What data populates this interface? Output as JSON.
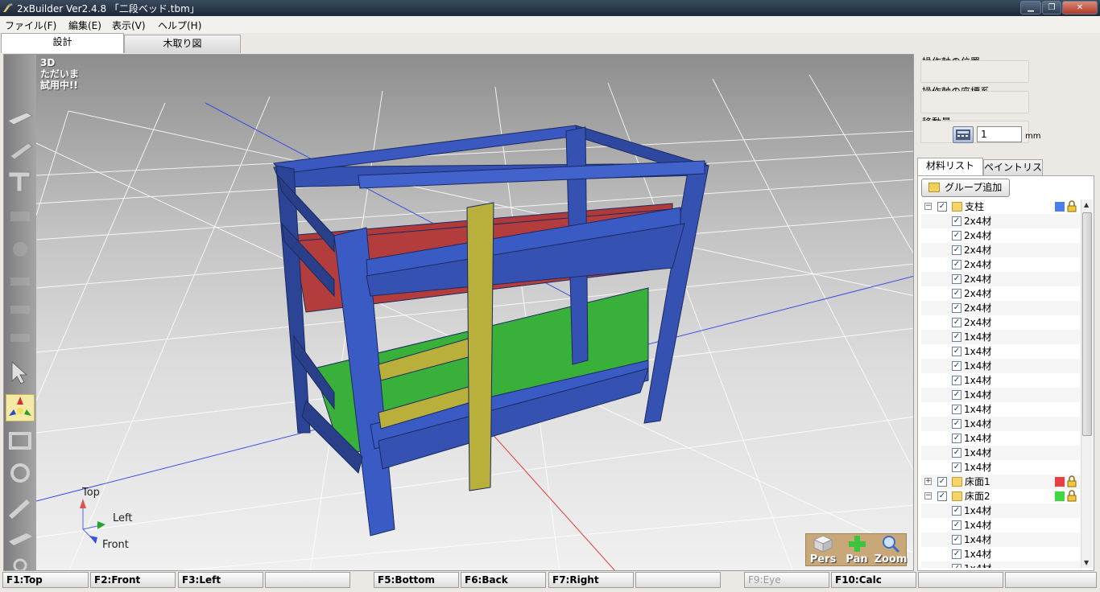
{
  "window": {
    "title": "2xBuilder Ver2.4.8 「二段ベッド.tbm」",
    "buttons": [
      "minimize",
      "maximize",
      "close"
    ]
  },
  "menu": [
    "ファイル(F)",
    "編集(E)",
    "表示(V)",
    "ヘルプ(H)"
  ],
  "tabs": [
    {
      "label": "設計",
      "active": true
    },
    {
      "label": "木取り図",
      "active": false
    }
  ],
  "viewport": {
    "overlay": [
      "3D",
      "ただいま",
      "試用中!!"
    ],
    "axis_labels": {
      "top": "Top",
      "left": "Left",
      "front": "Front"
    },
    "camera": [
      "Pers",
      "Pan",
      "Zoom"
    ],
    "tools": [
      "board-tool",
      "beam-tool",
      "t-joint-tool",
      "tool-4",
      "tool-5",
      "tool-6",
      "tool-7",
      "tool-8",
      "tool-9",
      "select-arrow-tool",
      "move-axis-tool",
      "rotate-tool",
      "flip-tool",
      "extend-tool",
      "scale-tool",
      "hide-tool"
    ],
    "active_tool": "move-axis-tool",
    "colors": {
      "frame": "#3552b3",
      "upper_deck": "#b03a3a",
      "lower_deck": "#38b03a",
      "ladder": "#b8b03a"
    }
  },
  "properties": {
    "axis_position_label": "操作軸の位置",
    "axis_coords_label": "操作軸の座標系",
    "move_amount_label": "移動量",
    "move_amount_value": "1",
    "unit": "mm"
  },
  "panel_tabs": [
    {
      "label": "材料リスト",
      "active": true
    },
    {
      "label": "ペイントリスト",
      "active": false
    }
  ],
  "add_group_label": "グループ追加",
  "tree": [
    {
      "type": "group",
      "label": "支柱",
      "expanded": true,
      "color": "#4a7ee8"
    },
    {
      "type": "item",
      "label": "2x4材"
    },
    {
      "type": "item",
      "label": "2x4材"
    },
    {
      "type": "item",
      "label": "2x4材"
    },
    {
      "type": "item",
      "label": "2x4材"
    },
    {
      "type": "item",
      "label": "2x4材"
    },
    {
      "type": "item",
      "label": "2x4材"
    },
    {
      "type": "item",
      "label": "2x4材"
    },
    {
      "type": "item",
      "label": "2x4材"
    },
    {
      "type": "item",
      "label": "1x4材"
    },
    {
      "type": "item",
      "label": "1x4材"
    },
    {
      "type": "item",
      "label": "1x4材"
    },
    {
      "type": "item",
      "label": "1x4材"
    },
    {
      "type": "item",
      "label": "1x4材"
    },
    {
      "type": "item",
      "label": "1x4材"
    },
    {
      "type": "item",
      "label": "1x4材"
    },
    {
      "type": "item",
      "label": "1x4材"
    },
    {
      "type": "item",
      "label": "1x4材"
    },
    {
      "type": "item",
      "label": "1x4材"
    },
    {
      "type": "group",
      "label": "床面1",
      "expanded": false,
      "color": "#e84040"
    },
    {
      "type": "group",
      "label": "床面2",
      "expanded": true,
      "color": "#40d840"
    },
    {
      "type": "item",
      "label": "1x4材"
    },
    {
      "type": "item",
      "label": "1x4材"
    },
    {
      "type": "item",
      "label": "1x4材"
    },
    {
      "type": "item",
      "label": "1x4材"
    },
    {
      "type": "item",
      "label": "1x4材"
    }
  ],
  "fkeys": [
    {
      "label": "F1:Top",
      "enabled": true
    },
    {
      "label": "F2:Front",
      "enabled": true
    },
    {
      "label": "F3:Left",
      "enabled": true
    },
    {
      "label": "",
      "enabled": true
    },
    {
      "label": "F5:Bottom",
      "enabled": true
    },
    {
      "label": "F6:Back",
      "enabled": true
    },
    {
      "label": "F7:Right",
      "enabled": true
    },
    {
      "label": "",
      "enabled": true
    },
    {
      "label": "F9:Eye",
      "enabled": false
    },
    {
      "label": "F10:Calc",
      "enabled": true
    },
    {
      "label": "",
      "enabled": true
    },
    {
      "label": "",
      "enabled": true
    }
  ]
}
